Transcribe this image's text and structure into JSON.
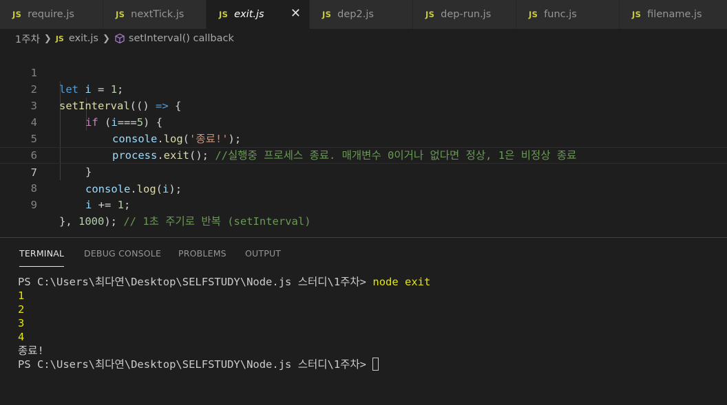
{
  "tabs": [
    {
      "icon": "JS",
      "label": "require.js",
      "active": false
    },
    {
      "icon": "JS",
      "label": "nextTick.js",
      "active": false
    },
    {
      "icon": "JS",
      "label": "exit.js",
      "active": true,
      "close": "✕"
    },
    {
      "icon": "JS",
      "label": "dep2.js",
      "active": false
    },
    {
      "icon": "JS",
      "label": "dep-run.js",
      "active": false
    },
    {
      "icon": "JS",
      "label": "func.js",
      "active": false
    },
    {
      "icon": "JS",
      "label": "filename.js",
      "active": false
    }
  ],
  "breadcrumb": {
    "folder": "1주차",
    "file_icon": "JS",
    "file": "exit.js",
    "symbol_icon": "cube-icon",
    "symbol": "setInterval() callback"
  },
  "editor": {
    "current_line": 7,
    "line_numbers": [
      "1",
      "2",
      "3",
      "4",
      "5",
      "6",
      "7",
      "8",
      "9"
    ],
    "code": {
      "l1": [
        "let",
        " ",
        "i",
        " = ",
        "1",
        ";"
      ],
      "l2": [
        "setInterval",
        "(() ",
        "=>",
        " {"
      ],
      "l3": [
        "if",
        " (",
        "i",
        "===",
        "5",
        ") {"
      ],
      "l4": [
        "console",
        ".",
        "log",
        "(",
        "'종료!'",
        ");"
      ],
      "l5": [
        "process",
        ".",
        "exit",
        "(); ",
        "//실행중 프로세스 종료. 매개변수 0이거나 없다면 정상, 1은 비정상 종료"
      ],
      "l6": [
        "}"
      ],
      "l7": [
        "console",
        ".",
        "log",
        "(",
        "i",
        ");"
      ],
      "l8": [
        "i",
        " += ",
        "1",
        ";"
      ],
      "l9": [
        "}, ",
        "1000",
        "); ",
        "// 1초 주기로 반복 (setInterval)"
      ]
    }
  },
  "panel": {
    "tabs": [
      "TERMINAL",
      "DEBUG CONSOLE",
      "PROBLEMS",
      "OUTPUT"
    ],
    "active_tab": "TERMINAL"
  },
  "terminal": {
    "prompt": "PS C:\\Users\\최다연\\Desktop\\SELFSTUDY\\Node.js 스터디\\1주차> ",
    "command": "node exit",
    "outputs": [
      "1",
      "2",
      "3",
      "4"
    ],
    "final_text": "종료!",
    "prompt2": "PS C:\\Users\\최다연\\Desktop\\SELFSTUDY\\Node.js 스터디\\1주차> "
  },
  "colors": {
    "keyword": "#569cd6",
    "control": "#c586c0",
    "variable": "#9cdcfe",
    "function": "#dcdcaa",
    "number": "#b5cea8",
    "string": "#ce9178",
    "comment": "#6a9955",
    "js_icon": "#cbcb41",
    "terminal_yellow": "#e5e510"
  }
}
